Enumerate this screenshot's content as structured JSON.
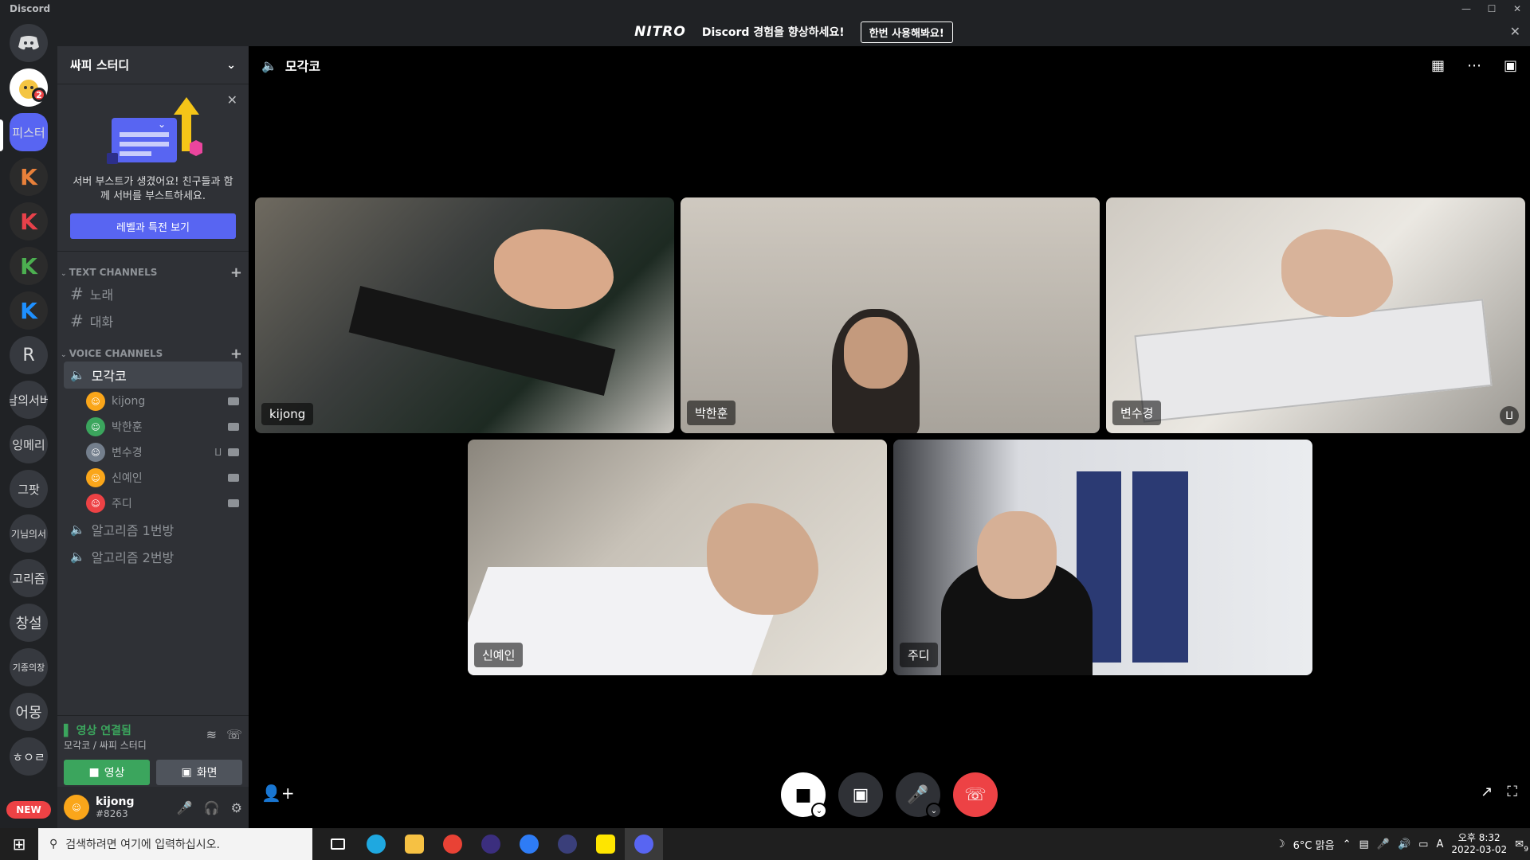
{
  "window": {
    "title": "Discord"
  },
  "nitro_banner": {
    "logo": "NITRO",
    "text": "Discord 경험을 향상하세요!",
    "button": "한번 사용해봐요!"
  },
  "guilds": {
    "items": [
      {
        "label": "",
        "icon": "discord-home-icon"
      },
      {
        "label": "",
        "icon": "avatar-icon",
        "badge": "2"
      },
      {
        "label": "피스터",
        "active": true
      },
      {
        "label": "K",
        "color": "#e8803a"
      },
      {
        "label": "K",
        "color": "#e8414a"
      },
      {
        "label": "K",
        "color": "#4caf50"
      },
      {
        "label": "K",
        "color": "#1e90ff"
      },
      {
        "label": "R"
      },
      {
        "label": "남의서버"
      },
      {
        "label": "잉메리"
      },
      {
        "label": "그팟"
      },
      {
        "label": "기님의서"
      },
      {
        "label": "고리즘"
      },
      {
        "label": "창설"
      },
      {
        "label": "기종의장"
      },
      {
        "label": "어몽"
      },
      {
        "label": "ㅎㅇㄹ"
      },
      {
        "label": "NEW"
      }
    ]
  },
  "sidebar": {
    "server_name": "싸피 스터디",
    "boost": {
      "text": "서버 부스트가 생겼어요! 친구들과 함께 서버를 부스트하세요.",
      "button": "레벨과 특전 보기"
    },
    "text_category": "TEXT CHANNELS",
    "text_channels": [
      "노래",
      "대화"
    ],
    "voice_category": "VOICE CHANNELS",
    "voice_channels": [
      {
        "name": "모각코",
        "active": true
      },
      {
        "name": "알고리즘 1번방"
      },
      {
        "name": "알고리즘 2번방"
      }
    ],
    "voice_users": [
      {
        "name": "kijong",
        "color": "#faa61a"
      },
      {
        "name": "박한훈",
        "color": "#3ba55d"
      },
      {
        "name": "변수경",
        "color": "#747f8d",
        "muted": true
      },
      {
        "name": "신예인",
        "color": "#faa61a"
      },
      {
        "name": "주디",
        "color": "#ed4245"
      }
    ],
    "voice_status": {
      "title": "영상 연결됨",
      "sub": "모각코 / 싸피 스터디",
      "video_btn": "영상",
      "screen_btn": "화면"
    },
    "user": {
      "name": "kijong",
      "tag": "#8263"
    }
  },
  "stage": {
    "channel": "모각코",
    "tiles": [
      {
        "name": "kijong"
      },
      {
        "name": "박한훈"
      },
      {
        "name": "변수경",
        "muted": true
      },
      {
        "name": "신예인"
      },
      {
        "name": "주디"
      }
    ]
  },
  "taskbar": {
    "search_placeholder": "검색하려면 여기에 입력하십시오.",
    "weather": "6°C 맑음",
    "ime": "A",
    "time": "오후 8:32",
    "date": "2022-03-02",
    "notifications": "9"
  },
  "colors": {
    "accent": "#5865f2",
    "green": "#3ba55d",
    "red": "#ed4245"
  }
}
